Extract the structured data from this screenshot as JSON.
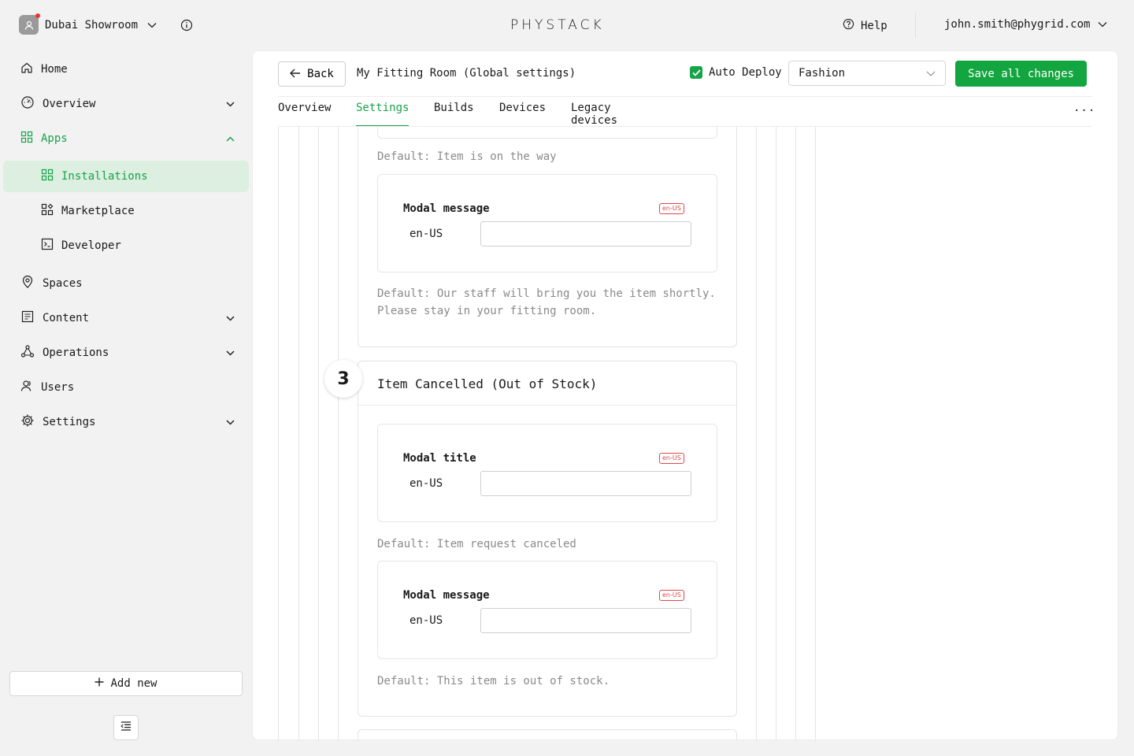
{
  "header": {
    "org_name": "Dubai Showroom",
    "logo": "PHYSTACK",
    "help_label": "Help",
    "user_email": "john.smith@phygrid.com"
  },
  "sidebar": {
    "items": [
      {
        "label": "Home",
        "icon": "home-icon"
      },
      {
        "label": "Overview",
        "icon": "dashboard-icon"
      },
      {
        "label": "Apps",
        "icon": "apps-icon"
      },
      {
        "label": "Installations",
        "icon": "grid-icon"
      },
      {
        "label": "Marketplace",
        "icon": "marketplace-icon"
      },
      {
        "label": "Developer",
        "icon": "terminal-icon"
      },
      {
        "label": "Spaces",
        "icon": "location-pin-icon"
      },
      {
        "label": "Content",
        "icon": "content-icon"
      },
      {
        "label": "Operations",
        "icon": "operations-icon"
      },
      {
        "label": "Users",
        "icon": "users-icon"
      },
      {
        "label": "Settings",
        "icon": "gear-icon"
      }
    ],
    "add_new_label": "Add new"
  },
  "toolbar": {
    "back_label": "Back",
    "title": "My Fitting Room (Global settings)",
    "auto_deploy_label": "Auto Deploy",
    "auto_deploy_checked": true,
    "select_value": "Fashion",
    "save_label": "Save all changes"
  },
  "tabs": [
    "Overview",
    "Settings",
    "Builds",
    "Devices",
    "Legacy devices"
  ],
  "active_tab": "Settings",
  "more_label": "...",
  "content": {
    "prev_default": "Default: Item is on the way",
    "prev_modal_message_label": "Modal message",
    "prev_modal_message_locale_badge": "en-US",
    "prev_modal_message_locale": "en-US",
    "prev_modal_message_default_line1": "Default: Our staff will bring you the item shortly.",
    "prev_modal_message_default_line2": "Please stay in your fitting room.",
    "step_number": "3",
    "step_title": "Item Cancelled (Out of Stock)",
    "modal_title_label": "Modal title",
    "modal_title_locale_badge": "en-US",
    "modal_title_locale": "en-US",
    "modal_title_default": "Default: Item request canceled",
    "modal_message_label": "Modal message",
    "modal_message_locale_badge": "en-US",
    "modal_message_locale": "en-US",
    "modal_message_default": "Default: This item is out of stock."
  },
  "colors": {
    "accent": "#17a34a",
    "save_button": "#13a53f",
    "selected_bg": "#dcefe0",
    "locale_badge": "#e04848"
  }
}
